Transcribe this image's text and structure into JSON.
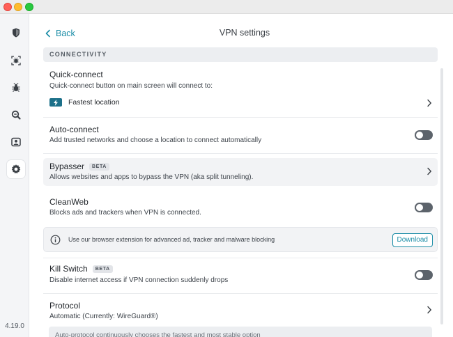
{
  "app": {
    "version": "4.19.0"
  },
  "sidebar": {
    "items": [
      {
        "icon": "shield-icon"
      },
      {
        "icon": "virus-scan-icon"
      },
      {
        "icon": "bug-icon"
      },
      {
        "icon": "search-icon"
      },
      {
        "icon": "contact-icon"
      },
      {
        "icon": "gear-icon",
        "active": true
      }
    ]
  },
  "header": {
    "back_label": "Back",
    "title": "VPN settings"
  },
  "section": {
    "title": "CONNECTIVITY"
  },
  "settings": {
    "quick_connect": {
      "title": "Quick-connect",
      "desc": "Quick-connect button on main screen will connect to:",
      "value": "Fastest location"
    },
    "auto_connect": {
      "title": "Auto-connect",
      "desc": "Add trusted networks and choose a location to connect automatically",
      "enabled": false
    },
    "bypasser": {
      "title": "Bypasser",
      "badge": "BETA",
      "desc": "Allows websites and apps to bypass the VPN (aka split tunneling)."
    },
    "cleanweb": {
      "title": "CleanWeb",
      "desc": "Blocks ads and trackers when VPN is connected.",
      "enabled": false,
      "info_text": "Use our browser extension for advanced ad, tracker and malware blocking",
      "download_label": "Download"
    },
    "kill_switch": {
      "title": "Kill Switch",
      "badge": "BETA",
      "desc": "Disable internet access if VPN connection suddenly drops",
      "enabled": false
    },
    "protocol": {
      "title": "Protocol",
      "desc": "Automatic (Currently: WireGuard®)",
      "note": "Auto-protocol continuously chooses the fastest and most stable option"
    }
  },
  "colors": {
    "accent": "#1a8ca6",
    "toggle_off": "#5c636b",
    "bolt_bg": "#1c7089"
  }
}
